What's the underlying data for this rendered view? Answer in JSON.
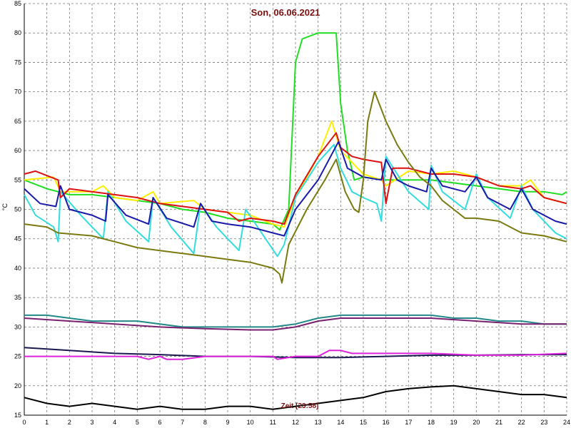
{
  "chart_data": {
    "type": "line",
    "title": "Son, 06.06.2021",
    "ylabel": "°C",
    "annotation": "Zeit [23:58]",
    "xlim": [
      0,
      24
    ],
    "ylim": [
      15,
      85
    ],
    "xticks": [
      0,
      1,
      2,
      3,
      4,
      5,
      6,
      7,
      8,
      9,
      10,
      11,
      12,
      13,
      14,
      15,
      16,
      17,
      18,
      19,
      20,
      21,
      22,
      23,
      24
    ],
    "yticks": [
      15,
      20,
      25,
      30,
      35,
      40,
      45,
      50,
      55,
      60,
      65,
      70,
      75,
      80,
      85
    ],
    "grid": true,
    "series": [
      {
        "color": "#22dd22",
        "points": [
          [
            0,
            55
          ],
          [
            1,
            53.5
          ],
          [
            2,
            52.5
          ],
          [
            3,
            52.5
          ],
          [
            4,
            52
          ],
          [
            5,
            51.5
          ],
          [
            6,
            51
          ],
          [
            7,
            50
          ],
          [
            8,
            49.5
          ],
          [
            9,
            48.5
          ],
          [
            10,
            48
          ],
          [
            11,
            47.5
          ],
          [
            11.3,
            46.5
          ],
          [
            11.7,
            50
          ],
          [
            12,
            75
          ],
          [
            12.3,
            79
          ],
          [
            13,
            80
          ],
          [
            13.8,
            80
          ],
          [
            14,
            68
          ],
          [
            14.3,
            60
          ],
          [
            14.6,
            55
          ],
          [
            15,
            55.5
          ],
          [
            16,
            55
          ],
          [
            17,
            55
          ],
          [
            18,
            55
          ],
          [
            19,
            54.5
          ],
          [
            20,
            54
          ],
          [
            21,
            53.5
          ],
          [
            22,
            53
          ],
          [
            23,
            53
          ],
          [
            23.8,
            52.5
          ],
          [
            24,
            53
          ]
        ]
      },
      {
        "color": "#ffee00",
        "points": [
          [
            0,
            55
          ],
          [
            1.3,
            55.5
          ],
          [
            1.6,
            53
          ],
          [
            3,
            53
          ],
          [
            3.5,
            54
          ],
          [
            4,
            52
          ],
          [
            5,
            51.5
          ],
          [
            5.7,
            53
          ],
          [
            6,
            51
          ],
          [
            7.5,
            51.5
          ],
          [
            8,
            50
          ],
          [
            9,
            49.5
          ],
          [
            10,
            49
          ],
          [
            11,
            47.5
          ],
          [
            11.5,
            47
          ],
          [
            12,
            52
          ],
          [
            13,
            59
          ],
          [
            13.6,
            65
          ],
          [
            14,
            60
          ],
          [
            15,
            56
          ],
          [
            15.8,
            55
          ],
          [
            16,
            54
          ],
          [
            17,
            56.5
          ],
          [
            18,
            56
          ],
          [
            19,
            56.5
          ],
          [
            20,
            55.5
          ],
          [
            21,
            54
          ],
          [
            22,
            54
          ],
          [
            22.4,
            55
          ],
          [
            23,
            52
          ],
          [
            24,
            51
          ]
        ]
      },
      {
        "color": "#33dddd",
        "points": [
          [
            0,
            52.5
          ],
          [
            0.5,
            49
          ],
          [
            1.3,
            47
          ],
          [
            1.5,
            44.5
          ],
          [
            1.6,
            53
          ],
          [
            2.5,
            49
          ],
          [
            3.5,
            45
          ],
          [
            3.7,
            53
          ],
          [
            4.5,
            48
          ],
          [
            5.5,
            44.5
          ],
          [
            5.7,
            52
          ],
          [
            6.5,
            47
          ],
          [
            7.5,
            42.5
          ],
          [
            7.8,
            51
          ],
          [
            8.5,
            47
          ],
          [
            9.5,
            43
          ],
          [
            9.8,
            50
          ],
          [
            10.5,
            46
          ],
          [
            11.2,
            42
          ],
          [
            11.5,
            44
          ],
          [
            12,
            52
          ],
          [
            13,
            58
          ],
          [
            13.7,
            61
          ],
          [
            14,
            57
          ],
          [
            14.5,
            53
          ],
          [
            15,
            52
          ],
          [
            15.6,
            51
          ],
          [
            15.8,
            48
          ],
          [
            16,
            59
          ],
          [
            16.5,
            56
          ],
          [
            17,
            53
          ],
          [
            17.9,
            50
          ],
          [
            18,
            57.5
          ],
          [
            18.5,
            53
          ],
          [
            19.5,
            50
          ],
          [
            20,
            56
          ],
          [
            20.5,
            52
          ],
          [
            21.5,
            48.5
          ],
          [
            22,
            54
          ],
          [
            22.5,
            50
          ],
          [
            23.5,
            46
          ],
          [
            24,
            45
          ]
        ]
      },
      {
        "color": "#dd1111",
        "points": [
          [
            0,
            56
          ],
          [
            0.5,
            56.5
          ],
          [
            1.5,
            55
          ],
          [
            1.6,
            52
          ],
          [
            2,
            53.5
          ],
          [
            3,
            53
          ],
          [
            4,
            52.5
          ],
          [
            5,
            52
          ],
          [
            6,
            51
          ],
          [
            7,
            50.5
          ],
          [
            8,
            50
          ],
          [
            9,
            49.5
          ],
          [
            9.5,
            48
          ],
          [
            10,
            48.5
          ],
          [
            11,
            48
          ],
          [
            11.5,
            47.5
          ],
          [
            12,
            52.5
          ],
          [
            13,
            59
          ],
          [
            13.8,
            63
          ],
          [
            14,
            60.5
          ],
          [
            14.5,
            59
          ],
          [
            15,
            58.5
          ],
          [
            15.8,
            58
          ],
          [
            16,
            51
          ],
          [
            16.3,
            57
          ],
          [
            17,
            57
          ],
          [
            18,
            56
          ],
          [
            19,
            56
          ],
          [
            20,
            55.5
          ],
          [
            21,
            54
          ],
          [
            22,
            53.5
          ],
          [
            22.4,
            54
          ],
          [
            23,
            52
          ],
          [
            24,
            51
          ]
        ]
      },
      {
        "color": "#1a1aaa",
        "points": [
          [
            0,
            53.5
          ],
          [
            0.7,
            51
          ],
          [
            1.4,
            50.5
          ],
          [
            1.6,
            54
          ],
          [
            2,
            50
          ],
          [
            3,
            49
          ],
          [
            3.6,
            48
          ],
          [
            3.7,
            52.5
          ],
          [
            4.5,
            49
          ],
          [
            5.5,
            47.5
          ],
          [
            5.7,
            52
          ],
          [
            6.3,
            48.5
          ],
          [
            7.5,
            47
          ],
          [
            7.8,
            51
          ],
          [
            8.3,
            48
          ],
          [
            9,
            47.5
          ],
          [
            10,
            47
          ],
          [
            11,
            46
          ],
          [
            11.5,
            45.5
          ],
          [
            12,
            50
          ],
          [
            13,
            55
          ],
          [
            13.9,
            61.5
          ],
          [
            14.3,
            57
          ],
          [
            15,
            55.5
          ],
          [
            15.8,
            55
          ],
          [
            16,
            58.5
          ],
          [
            16.5,
            55
          ],
          [
            17,
            54
          ],
          [
            17.8,
            53
          ],
          [
            18,
            57
          ],
          [
            18.5,
            54
          ],
          [
            19.5,
            53
          ],
          [
            20,
            55.5
          ],
          [
            20.5,
            52
          ],
          [
            21.5,
            50
          ],
          [
            22,
            53.5
          ],
          [
            22.5,
            50
          ],
          [
            23.5,
            48
          ],
          [
            24,
            47.5
          ]
        ]
      },
      {
        "color": "#7a7a10",
        "points": [
          [
            0,
            47.5
          ],
          [
            1,
            47
          ],
          [
            1.5,
            46
          ],
          [
            3,
            45.5
          ],
          [
            4,
            44.5
          ],
          [
            5,
            43.5
          ],
          [
            6,
            43
          ],
          [
            7,
            42.5
          ],
          [
            8,
            42
          ],
          [
            9,
            41.5
          ],
          [
            10,
            41
          ],
          [
            11,
            40
          ],
          [
            11.3,
            39
          ],
          [
            11.4,
            37.5
          ],
          [
            11.7,
            44
          ],
          [
            12.5,
            50
          ],
          [
            13.3,
            55
          ],
          [
            13.8,
            58.5
          ],
          [
            14.2,
            53
          ],
          [
            14.6,
            50
          ],
          [
            14.8,
            49.5
          ],
          [
            15,
            55
          ],
          [
            15.2,
            65
          ],
          [
            15.5,
            70
          ],
          [
            16,
            65
          ],
          [
            16.5,
            61
          ],
          [
            17,
            58
          ],
          [
            17.5,
            55.5
          ],
          [
            18,
            54
          ],
          [
            18.5,
            51.5
          ],
          [
            19.5,
            48.5
          ],
          [
            20,
            48.5
          ],
          [
            21,
            48
          ],
          [
            22,
            46
          ],
          [
            23,
            45.5
          ],
          [
            24,
            44.5
          ]
        ]
      },
      {
        "color": "#228888",
        "points": [
          [
            0,
            32
          ],
          [
            1,
            32
          ],
          [
            2,
            31.5
          ],
          [
            3,
            31
          ],
          [
            4,
            31
          ],
          [
            5,
            31
          ],
          [
            6,
            30.5
          ],
          [
            7,
            30
          ],
          [
            8,
            30
          ],
          [
            9,
            30
          ],
          [
            10,
            30
          ],
          [
            11,
            30
          ],
          [
            12,
            30.5
          ],
          [
            13,
            31.5
          ],
          [
            14,
            32
          ],
          [
            15,
            32
          ],
          [
            16,
            32
          ],
          [
            17,
            32
          ],
          [
            18,
            32
          ],
          [
            19,
            31.5
          ],
          [
            20,
            31.5
          ],
          [
            21,
            31
          ],
          [
            22,
            31
          ],
          [
            23,
            30.5
          ],
          [
            24,
            30.5
          ]
        ]
      },
      {
        "color": "#7a2070",
        "points": [
          [
            0,
            31.5
          ],
          [
            2,
            31
          ],
          [
            4,
            30.5
          ],
          [
            6,
            30
          ],
          [
            8,
            29.7
          ],
          [
            10,
            29.5
          ],
          [
            11,
            29.5
          ],
          [
            12,
            30
          ],
          [
            13,
            31
          ],
          [
            14,
            31.5
          ],
          [
            16,
            31.5
          ],
          [
            18,
            31.5
          ],
          [
            20,
            31
          ],
          [
            22,
            30.5
          ],
          [
            24,
            30.5
          ]
        ]
      },
      {
        "color": "#1a1a50",
        "points": [
          [
            0,
            26.5
          ],
          [
            2,
            26
          ],
          [
            4,
            25.5
          ],
          [
            6,
            25.3
          ],
          [
            8,
            25
          ],
          [
            10,
            25
          ],
          [
            12,
            24.8
          ],
          [
            14,
            24.8
          ],
          [
            16,
            25
          ],
          [
            18,
            25.2
          ],
          [
            20,
            25.2
          ],
          [
            22,
            25.3
          ],
          [
            24,
            25.3
          ]
        ]
      },
      {
        "color": "#dd22dd",
        "points": [
          [
            0,
            25
          ],
          [
            3,
            25
          ],
          [
            5,
            25
          ],
          [
            5.5,
            24.5
          ],
          [
            6,
            25
          ],
          [
            6.3,
            24.5
          ],
          [
            7,
            24.5
          ],
          [
            8,
            25
          ],
          [
            10,
            25
          ],
          [
            11,
            25
          ],
          [
            11.2,
            24.5
          ],
          [
            12,
            25
          ],
          [
            13,
            25
          ],
          [
            13.5,
            26
          ],
          [
            14,
            26
          ],
          [
            14.5,
            25.5
          ],
          [
            16,
            25.5
          ],
          [
            18,
            25.5
          ],
          [
            20,
            25.2
          ],
          [
            22,
            25.2
          ],
          [
            24,
            25.5
          ]
        ]
      },
      {
        "color": "#000000",
        "points": [
          [
            0,
            18
          ],
          [
            1,
            17
          ],
          [
            2,
            16.5
          ],
          [
            3,
            17
          ],
          [
            4,
            16.5
          ],
          [
            5,
            16
          ],
          [
            6,
            16.5
          ],
          [
            7,
            16
          ],
          [
            8,
            16
          ],
          [
            9,
            16.5
          ],
          [
            10,
            16.5
          ],
          [
            11,
            16
          ],
          [
            12,
            16.5
          ],
          [
            13,
            17
          ],
          [
            14,
            17.5
          ],
          [
            15,
            18
          ],
          [
            16,
            19
          ],
          [
            17,
            19.5
          ],
          [
            18,
            19.8
          ],
          [
            19,
            20
          ],
          [
            20,
            19.5
          ],
          [
            21,
            19
          ],
          [
            22,
            18.5
          ],
          [
            23,
            18.5
          ],
          [
            24,
            18
          ]
        ]
      }
    ]
  }
}
